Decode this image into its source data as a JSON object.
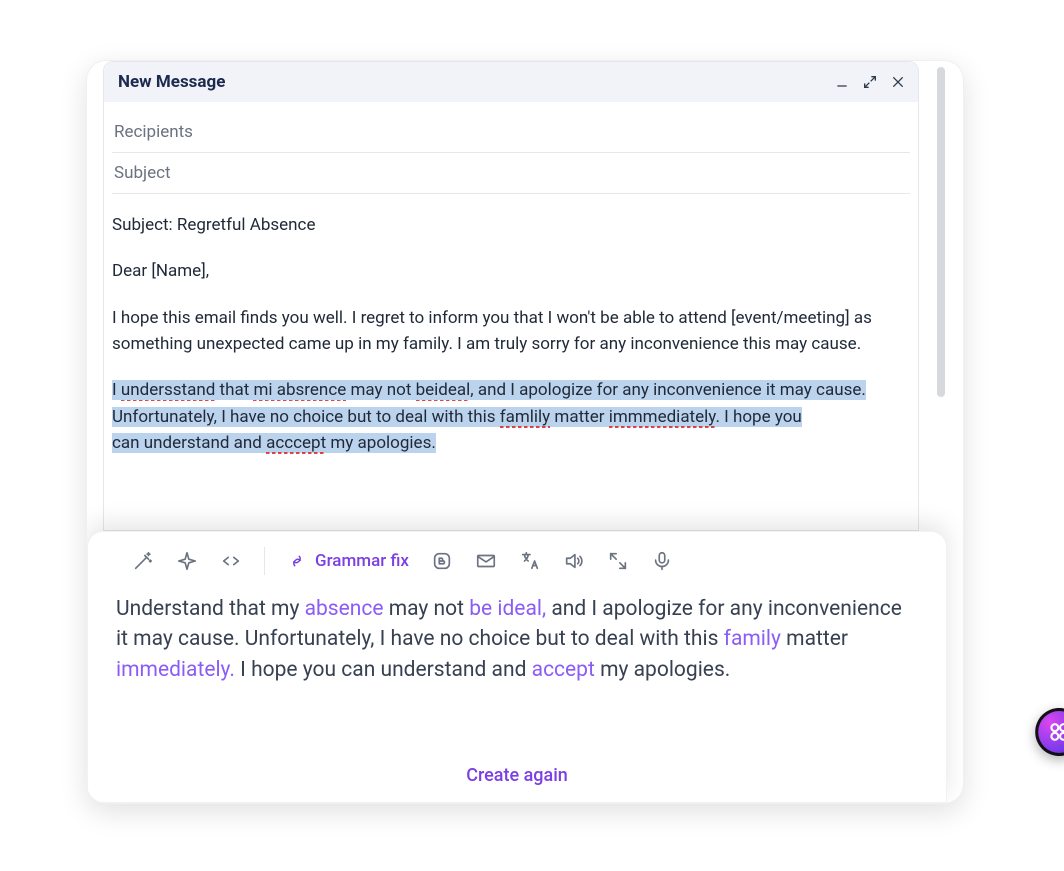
{
  "compose": {
    "title": "New Message",
    "recipients_placeholder": "Recipients",
    "subject_placeholder": "Subject",
    "subject_line": "Subject: Regretful Absence",
    "greeting": "Dear [Name],",
    "para1": "I hope this email finds you well. I regret to inform you that I won't be able to attend [event/meeting] as something unexpected came up in my family. I am truly sorry for any inconvenience this may cause.",
    "para2": {
      "seg1_pre": "I ",
      "word1": "undersstand",
      "seg1_post": " that ",
      "word2": "mi absrence",
      "seg2": " may not ",
      "word3": "beideal",
      "seg3": ", and I apologize for any inconvenience it may cause. Unfortunately, I have no choice but to deal with this ",
      "word4": "famlily",
      "seg4": " matter ",
      "word5": "immmediately",
      "seg5_linebreak": ". I hope you ",
      "seg6": "can understand and ",
      "word6": "acccept",
      "seg7": " my apologies."
    }
  },
  "ai": {
    "toolbar": {
      "grammar_fix_label": "Grammar fix"
    },
    "correction": {
      "t1": "Understand that my ",
      "fix1": "absence",
      "t2": " may not ",
      "fix2": "be ideal,",
      "t3": " and I apologize for any inconvenience it may cause. Unfortunately, I have no choice but to deal with this ",
      "fix3": "family",
      "t4": " matter ",
      "fix4": "immediately.",
      "t5": " I hope you can understand and ",
      "fix5": "accept",
      "t6": " my apologies."
    },
    "create_again": "Create again"
  }
}
